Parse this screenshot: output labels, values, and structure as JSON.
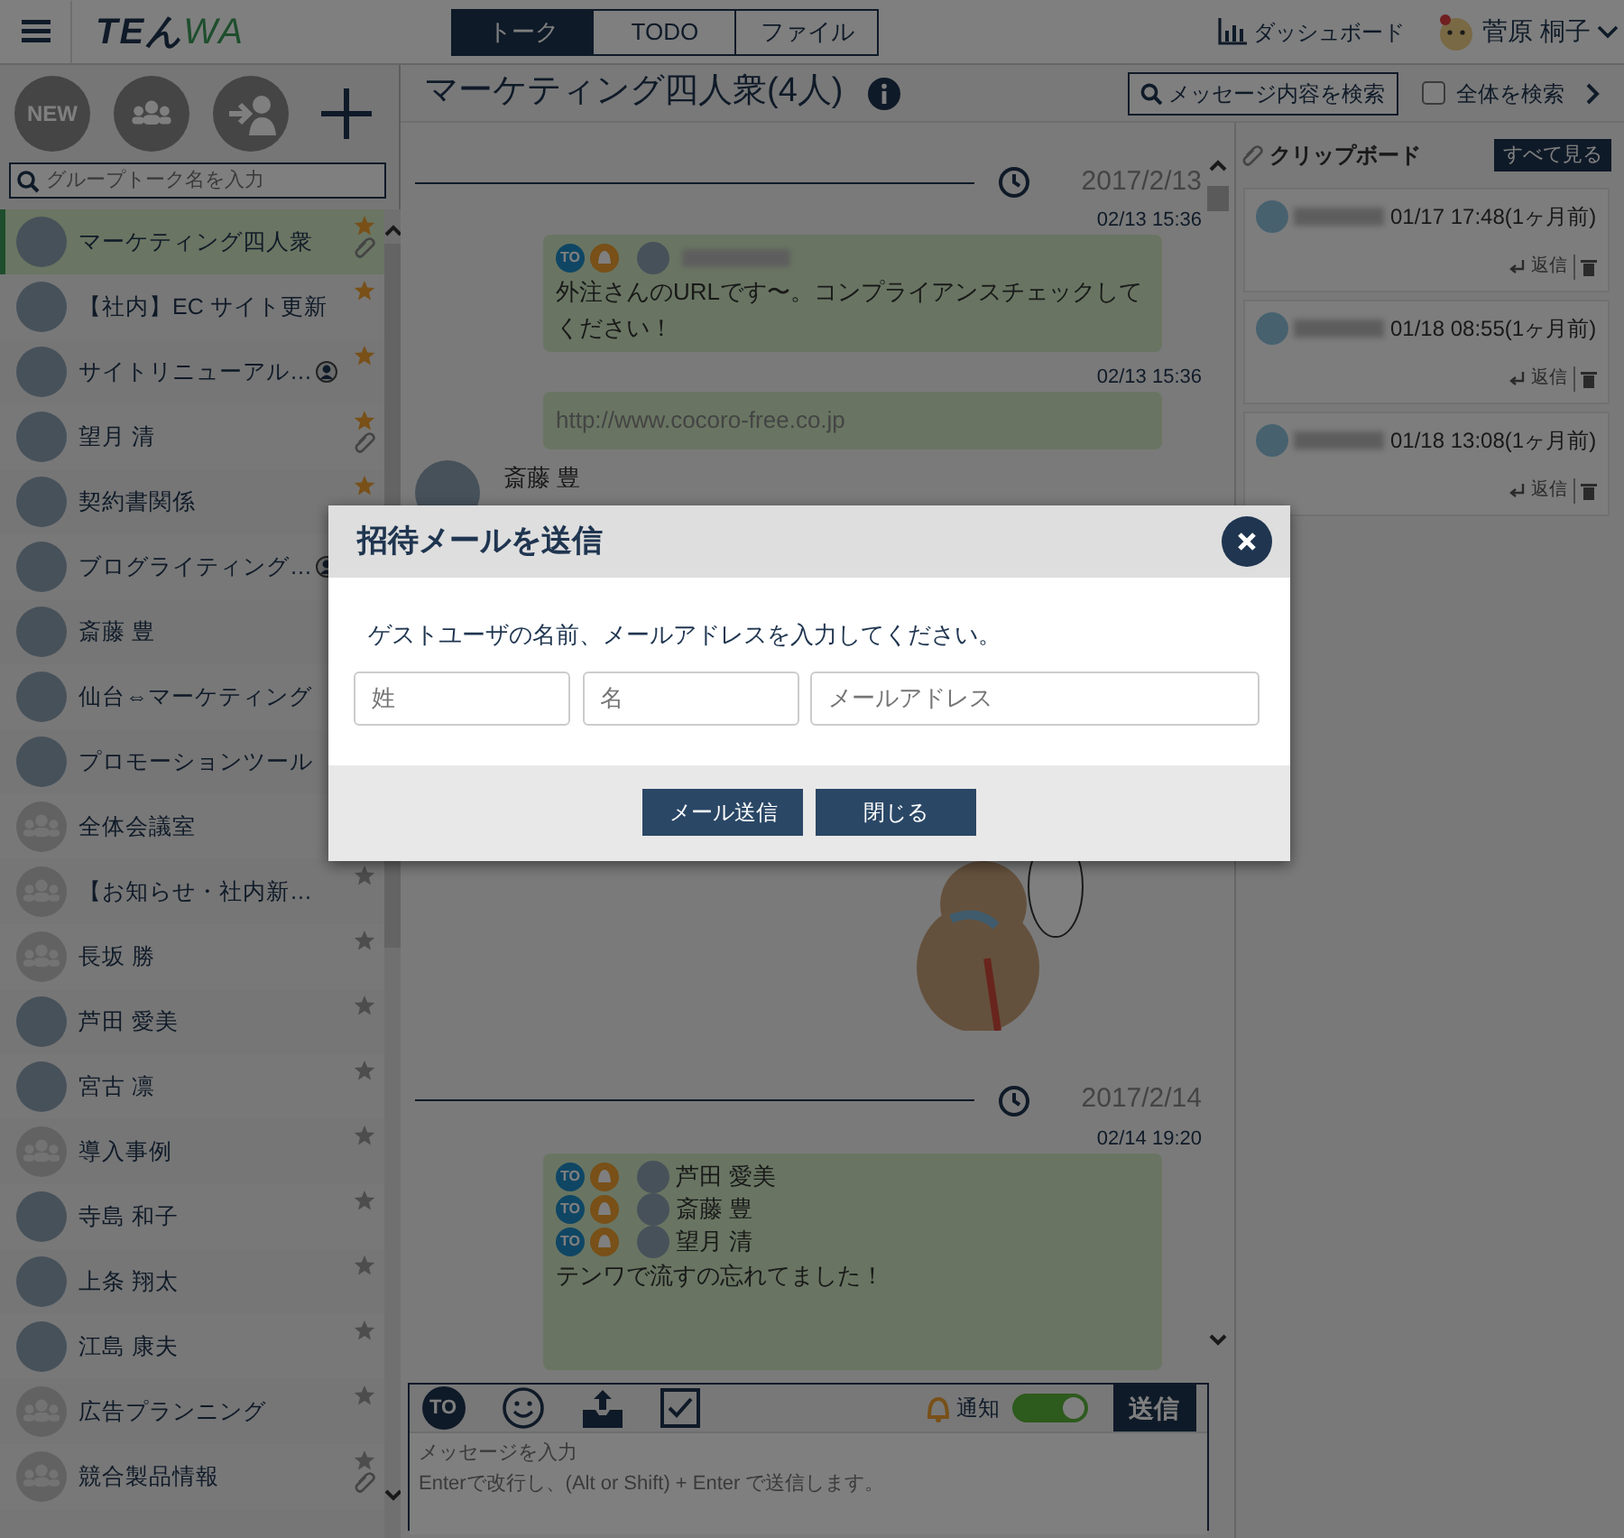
{
  "logo": [
    "TEん",
    "WA"
  ],
  "top_tabs": [
    {
      "label": "トーク",
      "selected": true
    },
    {
      "label": "TODO",
      "selected": false
    },
    {
      "label": "ファイル",
      "selected": false
    }
  ],
  "dashboard": "ダッシュボード",
  "user": {
    "name": "菅原 桐子"
  },
  "sidebar": {
    "new_button": "NEW",
    "search": {
      "placeholder": "グループトーク名を入力"
    },
    "items": [
      {
        "name": "マーケティング四人衆",
        "kind": "picture",
        "selected": true,
        "starred": true,
        "clipped": true,
        "member_badge": false
      },
      {
        "name": "【社内】EC サイト更新",
        "kind": "picture",
        "selected": false,
        "starred": true,
        "clipped": false,
        "member_badge": false
      },
      {
        "name": "サイトリニューアル…",
        "kind": "picture",
        "selected": false,
        "starred": true,
        "clipped": false,
        "member_badge": true
      },
      {
        "name": "望月 清",
        "kind": "picture",
        "selected": false,
        "starred": true,
        "clipped": true,
        "member_badge": false
      },
      {
        "name": "契約書関係",
        "kind": "picture",
        "selected": false,
        "starred": true,
        "clipped": false,
        "member_badge": false
      },
      {
        "name": "ブログライティング…",
        "kind": "picture",
        "selected": false,
        "member_badge": true
      },
      {
        "name": "斎藤 豊",
        "kind": "picture",
        "selected": false,
        "member_badge": false
      },
      {
        "name": "仙台⇔マーケティング",
        "kind": "picture",
        "selected": false,
        "member_badge": false
      },
      {
        "name": "プロモーションツール",
        "kind": "picture",
        "selected": false,
        "member_badge": false
      },
      {
        "name": "全体会議室",
        "kind": "group",
        "selected": false,
        "member_badge": false
      },
      {
        "name": "【お知らせ・社内新…",
        "kind": "group",
        "selected": false,
        "starred": false,
        "clipped": false,
        "member_badge": false
      },
      {
        "name": "長坂 勝",
        "kind": "group",
        "selected": false,
        "starred": false,
        "clipped": false,
        "member_badge": false
      },
      {
        "name": "芦田 愛美",
        "kind": "picture",
        "selected": false,
        "starred": false,
        "clipped": false,
        "member_badge": false
      },
      {
        "name": "宮古 凛",
        "kind": "picture",
        "selected": false,
        "starred": false,
        "clipped": false,
        "member_badge": false
      },
      {
        "name": "導入事例",
        "kind": "group",
        "selected": false,
        "starred": false,
        "clipped": false,
        "member_badge": false
      },
      {
        "name": "寺島 和子",
        "kind": "picture",
        "selected": false,
        "starred": false,
        "clipped": false,
        "member_badge": false
      },
      {
        "name": "上条 翔太",
        "kind": "picture",
        "selected": false,
        "starred": false,
        "clipped": false,
        "member_badge": false
      },
      {
        "name": "江島 康夫",
        "kind": "picture",
        "selected": false,
        "starred": false,
        "clipped": false,
        "member_badge": false
      },
      {
        "name": "広告プランニング",
        "kind": "group",
        "selected": false,
        "starred": false,
        "clipped": false,
        "member_badge": false
      },
      {
        "name": "競合製品情報",
        "kind": "group",
        "selected": false,
        "starred": false,
        "clipped": true,
        "member_badge": false
      }
    ]
  },
  "chat": {
    "title": "マーケティング四人衆(4人)",
    "search_button": "メッセージ内容を検索",
    "global_search": {
      "label": "全体を検索",
      "checked": false
    },
    "timeline": [
      {
        "kind": "date",
        "date": "2017/2/13"
      },
      {
        "kind": "time",
        "time": "02/13 15:36"
      },
      {
        "kind": "message",
        "recipients": [
          {
            "to": "TO"
          }
        ],
        "text": "外注さんのURLです〜。コンプライアンスチェックしてください！"
      },
      {
        "kind": "time",
        "time": "02/13 15:36"
      },
      {
        "kind": "link",
        "url": "http://www.cocoro-free.co.jp"
      },
      {
        "kind": "sender",
        "name": "斎藤 豊"
      },
      {
        "kind": "sticker"
      },
      {
        "kind": "date",
        "date": "2017/2/14"
      },
      {
        "kind": "time",
        "time": "02/14 19:20"
      },
      {
        "kind": "message",
        "recipients": [
          {
            "to": "TO",
            "name": "芦田 愛美"
          },
          {
            "to": "TO",
            "name": "斎藤 豊"
          },
          {
            "to": "TO",
            "name": "望月 清"
          }
        ],
        "text": "テンワで流すの忘れてました！"
      }
    ]
  },
  "clipboard": {
    "title": "クリップボード",
    "see_all": "すべて見る",
    "items": [
      {
        "time": "01/17 17:48(1ヶ月前)",
        "reply": "返信"
      },
      {
        "time": "01/18 08:55(1ヶ月前)",
        "reply": "返信"
      },
      {
        "time": "01/18 13:08(1ヶ月前)",
        "reply": "返信"
      }
    ]
  },
  "composer": {
    "to_button": "TO",
    "notify": {
      "label": "通知",
      "on": true
    },
    "send": "送信",
    "placeholder": "メッセージを入力\nEnterで改行し、(Alt or Shift) + Enter で送信します。"
  },
  "modal": {
    "title": "招待メールを送信",
    "instructions": "ゲストユーザの名前、メールアドレスを入力してください。",
    "fields": [
      {
        "placeholder": "姓"
      },
      {
        "placeholder": "名"
      },
      {
        "placeholder": "メールアドレス"
      }
    ],
    "buttons": [
      "メール送信",
      "閉じる"
    ]
  }
}
